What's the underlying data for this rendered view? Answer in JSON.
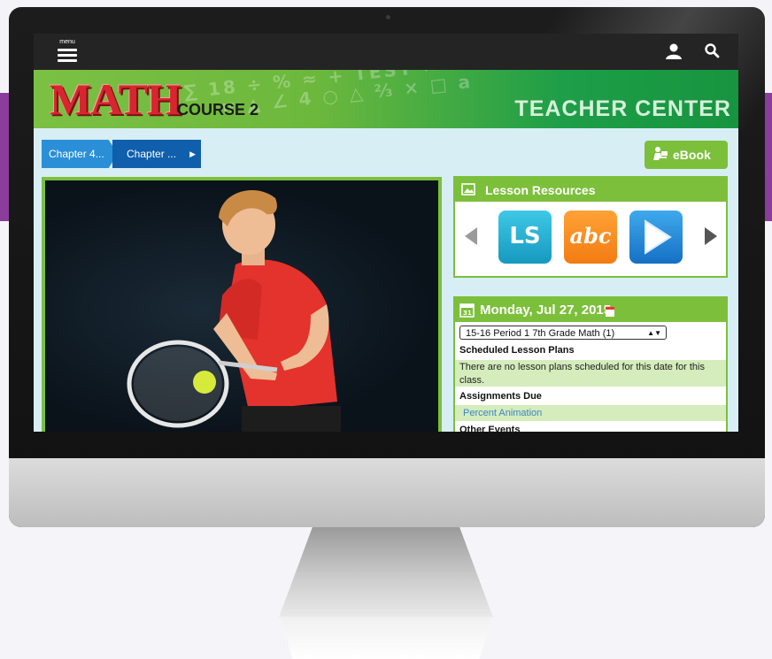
{
  "screen": {
    "topbar": {
      "menu_label": "menu"
    },
    "banner": {
      "logo_text": "MATH",
      "course": "COURSE 2",
      "section": "TEACHER CENTER"
    },
    "breadcrumb": {
      "items": [
        "Chapter 4...",
        "Chapter ..."
      ]
    },
    "ebook_button": {
      "label": "eBook"
    },
    "lesson_resources": {
      "title": "Lesson Resources",
      "tiles": [
        {
          "label": "LS",
          "icon": "ls-icon",
          "color": "#1fb0d6"
        },
        {
          "label": "abc",
          "icon": "abc-icon",
          "color": "#f58a1f"
        },
        {
          "label": "",
          "icon": "play-icon",
          "color": "#2b8de0"
        }
      ]
    },
    "calendar": {
      "date": "Monday, Jul 27, 2015",
      "class_select": {
        "selected": "15-16 Period 1 7th Grade Math (1)"
      },
      "sections": {
        "scheduled_heading": "Scheduled Lesson Plans",
        "scheduled_message": "There are no lesson plans scheduled for this date for this class.",
        "assignments_heading": "Assignments Due",
        "assignment_item": "Percent Animation",
        "other_events_heading": "Other Events"
      }
    }
  },
  "colors": {
    "accent_green": "#7cbf3b",
    "breadcrumb_light": "#2a8fd6",
    "breadcrumb_dark": "#0f5fad",
    "background_band": "#8a3d9a",
    "screen_bg": "#d7eef5"
  }
}
